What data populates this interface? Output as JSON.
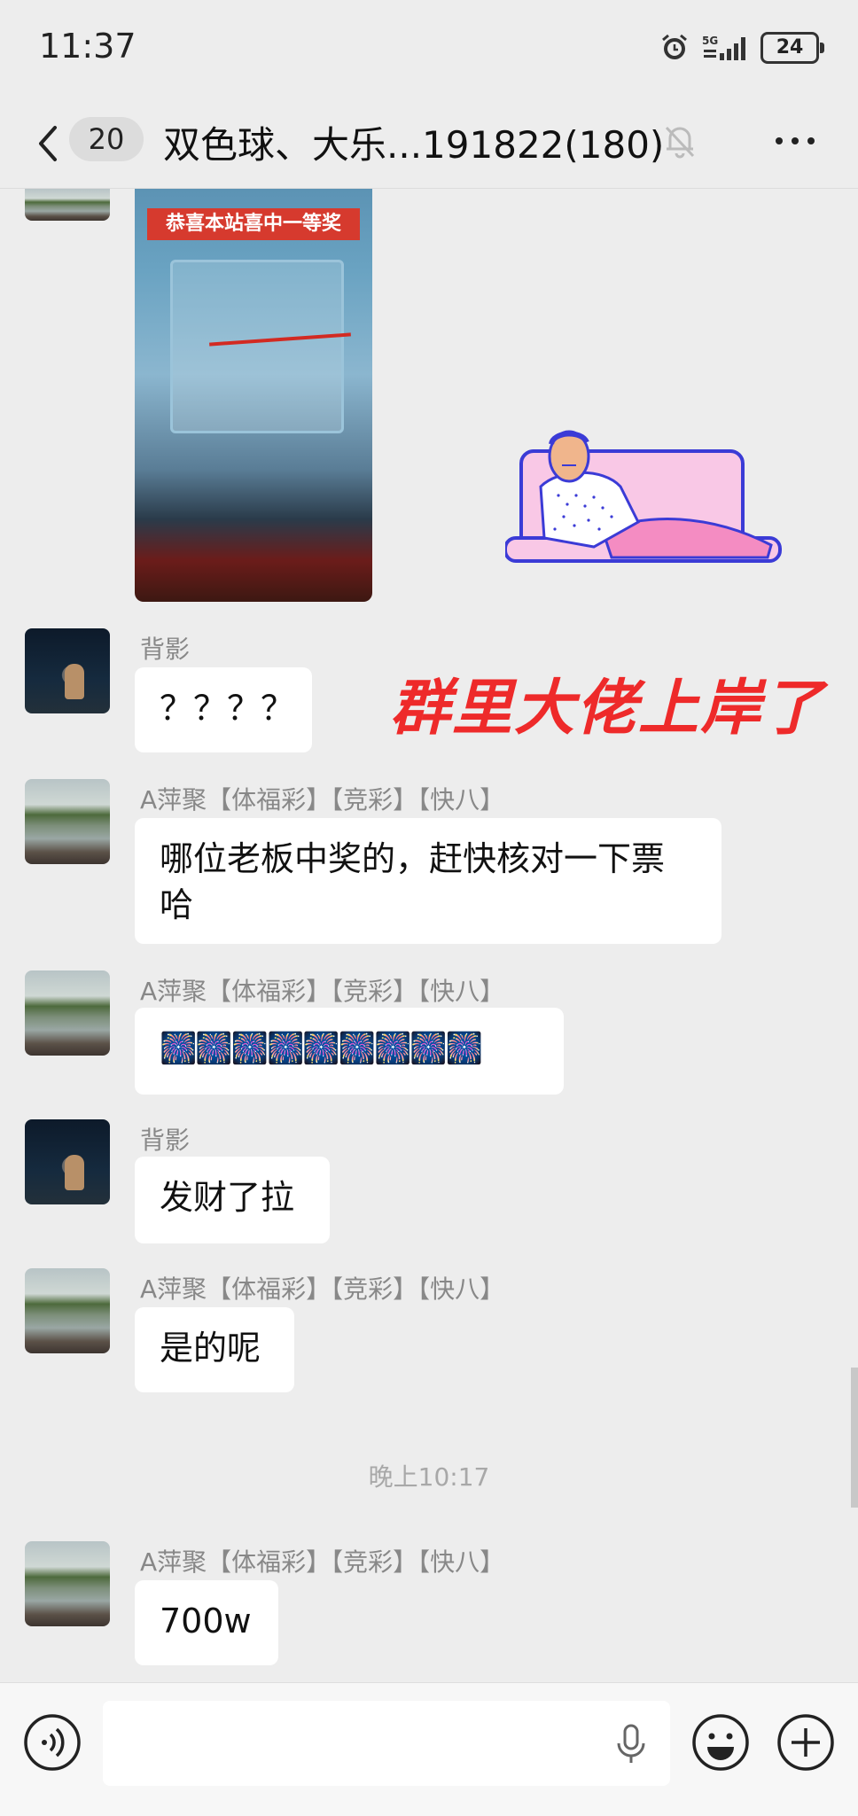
{
  "status_bar": {
    "time": "11:37",
    "network": "5G",
    "battery": "24"
  },
  "header": {
    "unread_count": "20",
    "title": "双色球、大乐...191822(180)"
  },
  "photo_message": {
    "banner_text": "恭喜本站喜中一等奖"
  },
  "overlay_caption": "群里大佬上岸了",
  "messages": [
    {
      "sender": "背影",
      "text": "？？？？"
    },
    {
      "sender": "A萍聚【体福彩】【竞彩】【快八】",
      "text": "哪位老板中奖的，赶快核对一下票哈"
    },
    {
      "sender": "A萍聚【体福彩】【竞彩】【快八】",
      "text": "🎆🎆🎆🎆🎆🎆🎆🎆🎆"
    },
    {
      "sender": "背影",
      "text": "发财了拉"
    },
    {
      "sender": "A萍聚【体福彩】【竞彩】【快八】",
      "text": "是的呢"
    },
    {
      "sender": "A萍聚【体福彩】【竞彩】【快八】",
      "text": "700w"
    }
  ],
  "timestamp": "晚上10:17",
  "input": {
    "placeholder": ""
  }
}
